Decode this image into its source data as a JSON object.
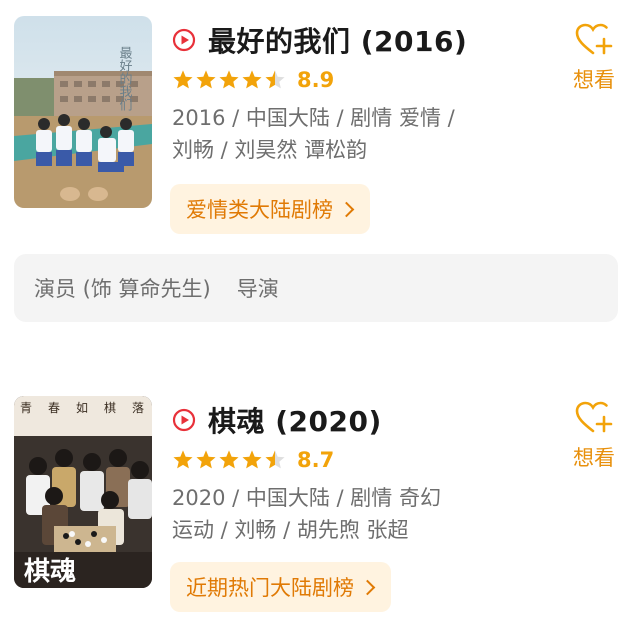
{
  "movies": [
    {
      "title": "最好的我们 (2016)",
      "score": "8.9",
      "stars": 4.5,
      "meta_line1": "2016 / 中国大陆 / 剧情 爱情 /",
      "meta_line2": "刘畅 / 刘昊然 谭松韵",
      "rank_label": "爱情类大陆剧榜",
      "want_label": "想看",
      "poster_text": "最好的我们"
    },
    {
      "title": "棋魂 (2020)",
      "score": "8.7",
      "stars": 4.5,
      "meta_line1": "2020 / 中国大陆 / 剧情 奇幻",
      "meta_line2": "运动 / 刘畅 / 胡先煦 张超",
      "rank_label": "近期热门大陆剧榜",
      "want_label": "想看",
      "poster_text": "棋魂",
      "poster_tagline": "青春如棋落子无悔"
    }
  ],
  "credits": {
    "role": "演员 (饰 算命先生)",
    "director": "导演"
  },
  "colors": {
    "accent": "#f2a30a",
    "play": "#e8313a",
    "chip_bg": "#fff3e0",
    "chip_text": "#e07a05"
  }
}
